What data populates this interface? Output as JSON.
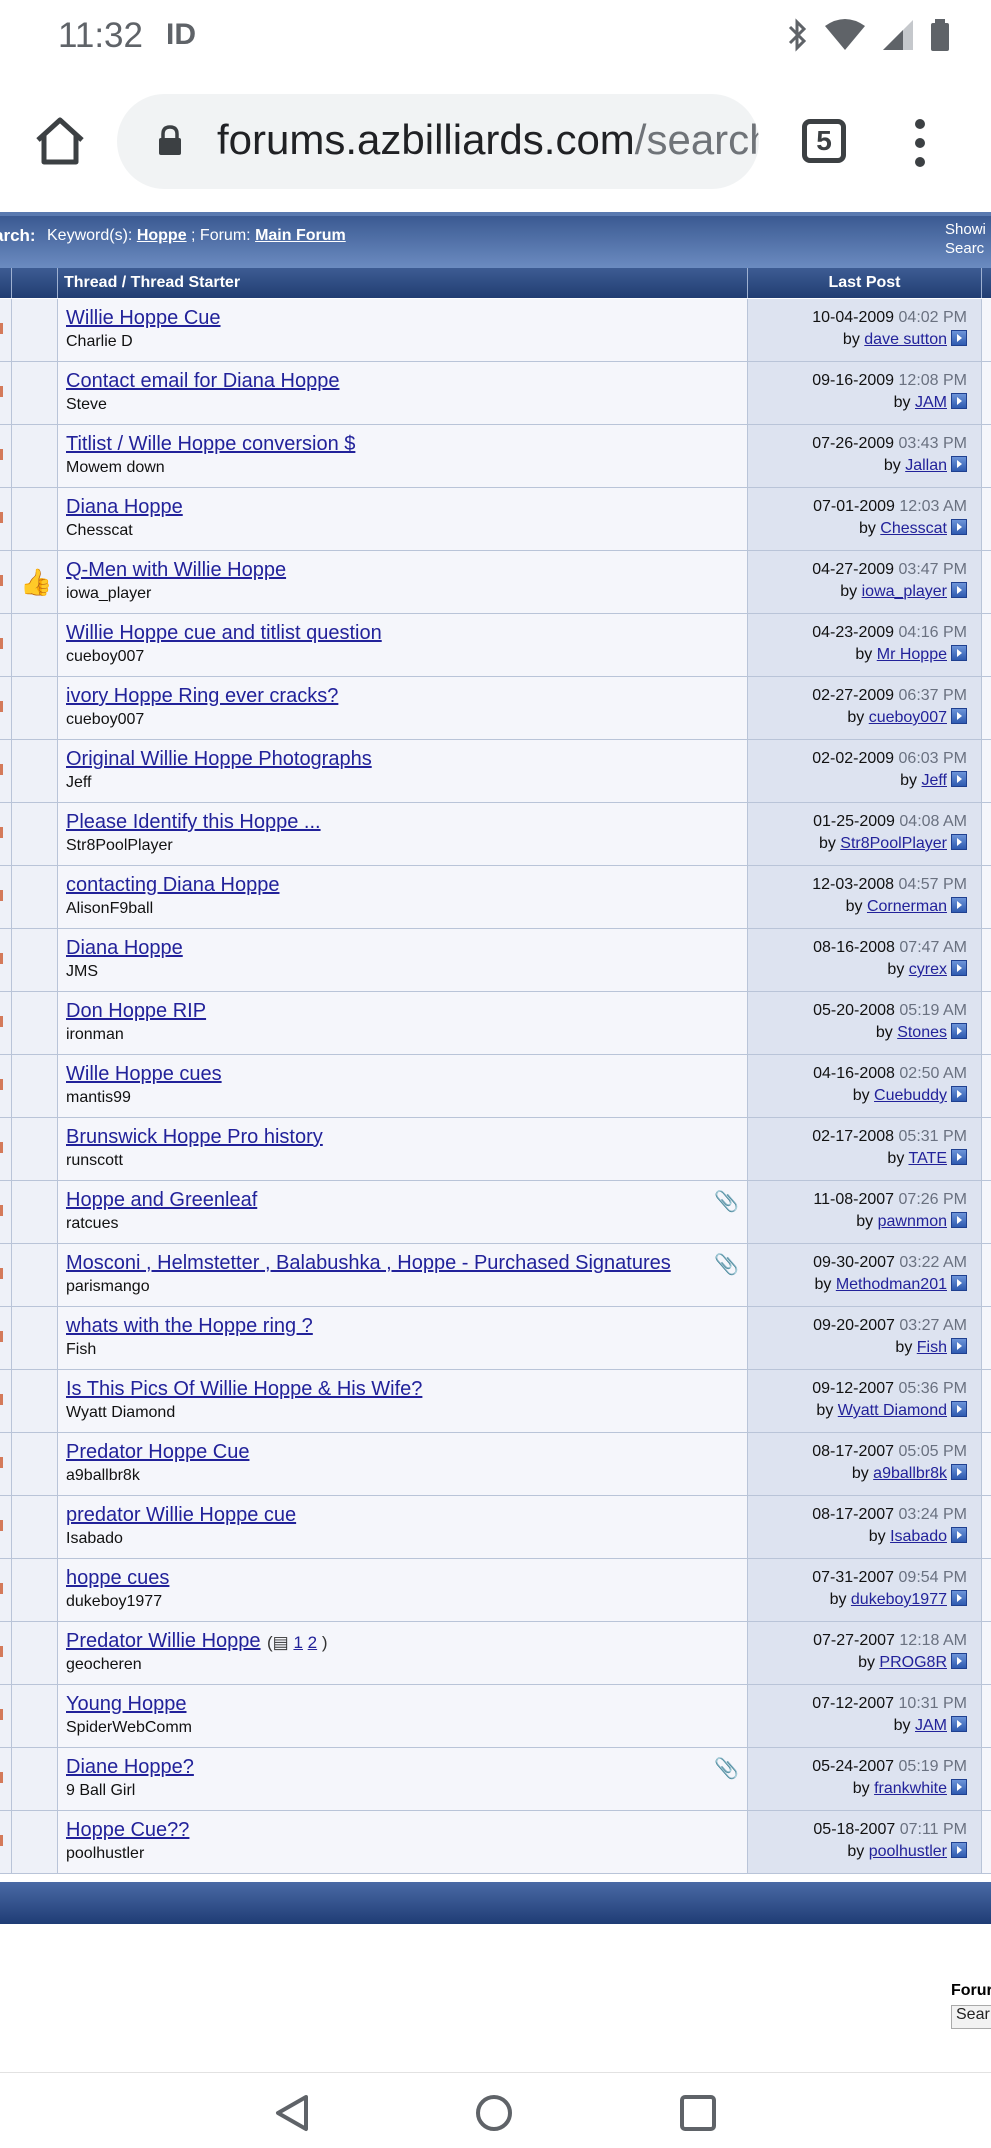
{
  "status": {
    "time": "11:32",
    "carrier": "ID"
  },
  "browser": {
    "url_main": "forums.azbilliards.com",
    "url_rest": "/search",
    "tab_count": "5"
  },
  "search_bar": {
    "label": "arch:",
    "keyword_prefix": "Keyword(s):",
    "keyword": "Hoppe",
    "separator": " ; Forum:",
    "forum": "Main Forum",
    "right_line1": "Showi",
    "right_line2": "Searc"
  },
  "table": {
    "col_thread": "Thread / Thread Starter",
    "col_lastpost": "Last Post"
  },
  "threads": [
    {
      "title": "Willie Hoppe Cue",
      "starter": "Charlie D",
      "date": "10-04-2009",
      "time": "04:02 PM",
      "by": "dave sutton"
    },
    {
      "title": "Contact email for Diana Hoppe",
      "starter": "Steve",
      "date": "09-16-2009",
      "time": "12:08 PM",
      "by": "JAM"
    },
    {
      "title": "Titlist / Wille Hoppe conversion $",
      "starter": "Mowem down",
      "date": "07-26-2009",
      "time": "03:43 PM",
      "by": "Jallan"
    },
    {
      "title": "Diana Hoppe",
      "starter": "Chesscat",
      "date": "07-01-2009",
      "time": "12:03 AM",
      "by": "Chesscat"
    },
    {
      "title": "Q-Men with Willie Hoppe",
      "starter": "iowa_player",
      "date": "04-27-2009",
      "time": "03:47 PM",
      "by": "iowa_player",
      "thumb": true
    },
    {
      "title": "Willie Hoppe cue and titlist question",
      "starter": "cueboy007",
      "date": "04-23-2009",
      "time": "04:16 PM",
      "by": "Mr Hoppe"
    },
    {
      "title": "ivory Hoppe Ring ever cracks? ",
      "starter": "cueboy007",
      "date": "02-27-2009",
      "time": "06:37 PM",
      "by": "cueboy007"
    },
    {
      "title": "Original Willie Hoppe Photographs",
      "starter": "Jeff",
      "date": "02-02-2009",
      "time": "06:03 PM",
      "by": "Jeff"
    },
    {
      "title": "Please Identify this Hoppe ...",
      "starter": "Str8PoolPlayer",
      "date": "01-25-2009",
      "time": "04:08 AM",
      "by": "Str8PoolPlayer"
    },
    {
      "title": "contacting Diana Hoppe",
      "starter": "AlisonF9ball",
      "date": "12-03-2008",
      "time": "04:57 PM",
      "by": "Cornerman"
    },
    {
      "title": "Diana Hoppe",
      "starter": "JMS",
      "date": "08-16-2008",
      "time": "07:47 AM",
      "by": "cyrex"
    },
    {
      "title": "Don Hoppe RIP",
      "starter": "ironman",
      "date": "05-20-2008",
      "time": "05:19 AM",
      "by": "Stones"
    },
    {
      "title": "Wille Hoppe cues",
      "starter": "mantis99",
      "date": "04-16-2008",
      "time": "02:50 AM",
      "by": "Cuebuddy"
    },
    {
      "title": "Brunswick Hoppe Pro history",
      "starter": "runscott",
      "date": "02-17-2008",
      "time": "05:31 PM",
      "by": "TATE"
    },
    {
      "title": "Hoppe and Greenleaf",
      "starter": "ratcues",
      "date": "11-08-2007",
      "time": "07:26 PM",
      "by": "pawnmon",
      "clip": true
    },
    {
      "title": "Mosconi , Helmstetter , Balabushka , Hoppe - Purchased Signatures",
      "starter": "parismango",
      "date": "09-30-2007",
      "time": "03:22 AM",
      "by": "Methodman201",
      "clip": true
    },
    {
      "title": "whats with the Hoppe ring ?",
      "starter": "Fish",
      "date": "09-20-2007",
      "time": "03:27 AM",
      "by": "Fish"
    },
    {
      "title": "Is This Pics Of Willie Hoppe & His Wife?",
      "starter": "Wyatt Diamond",
      "date": "09-12-2007",
      "time": "05:36 PM",
      "by": "Wyatt Diamond"
    },
    {
      "title": "Predator Hoppe Cue",
      "starter": "a9ballbr8k",
      "date": "08-17-2007",
      "time": "05:05 PM",
      "by": "a9ballbr8k"
    },
    {
      "title": "predator Willie Hoppe cue",
      "starter": "Isabado",
      "date": "08-17-2007",
      "time": "03:24 PM",
      "by": "Isabado"
    },
    {
      "title": "hoppe cues",
      "starter": "dukeboy1977",
      "date": "07-31-2007",
      "time": "09:54 PM",
      "by": "dukeboy1977"
    },
    {
      "title": "Predator Willie Hoppe",
      "starter": "geocheren",
      "date": "07-27-2007",
      "time": "12:18 AM",
      "by": "PROG8R",
      "pages": [
        "1",
        "2"
      ]
    },
    {
      "title": "Young Hoppe",
      "starter": "SpiderWebComm",
      "date": "07-12-2007",
      "time": "10:31 PM",
      "by": "JAM"
    },
    {
      "title": "Diane Hoppe?",
      "starter": "9 Ball Girl",
      "date": "05-24-2007",
      "time": "05:19 PM",
      "by": "frankwhite",
      "clip": true
    },
    {
      "title": "Hoppe Cue??",
      "starter": "poolhustler",
      "date": "05-18-2007",
      "time": "07:11 PM",
      "by": "poolhustler"
    }
  ],
  "labels": {
    "by_prefix": "by "
  },
  "footer": {
    "forum_label": "Forur",
    "search_button": "Sear"
  },
  "colors": {
    "accent_blue": "#3b5a92",
    "link": "#22229a"
  }
}
